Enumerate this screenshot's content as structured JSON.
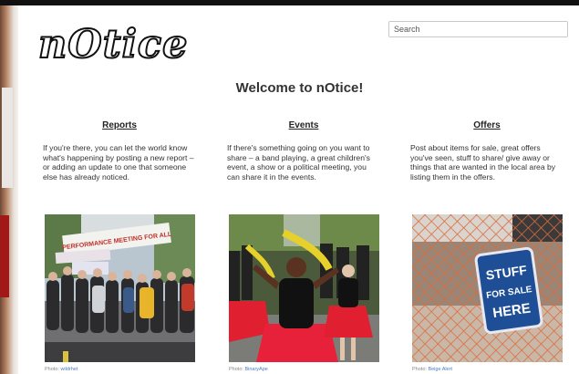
{
  "header": {
    "logo_text": "nOtice",
    "search_placeholder": "Search"
  },
  "main": {
    "welcome": "Welcome to nOtice!",
    "columns": [
      {
        "heading": "Reports",
        "text": "If you're there, you can let the world know what's happening by posting a new report – or adding an update to one that someone else has already noticed.",
        "photo_credit_prefix": "Photo:",
        "photo_credit_name": "wildrhet"
      },
      {
        "heading": "Events",
        "text": "If there's something going on you want to share – a band playing, a great children's event, a show or a political meeting, you can share it in the events.",
        "photo_credit_prefix": "Photo:",
        "photo_credit_name": "BinaryApe"
      },
      {
        "heading": "Offers",
        "text": "Post about items for sale, great offers you've seen, stuff to share/ give away or things that are wanted in the local area by listing them in the offers.",
        "photo_credit_prefix": "Photo:",
        "photo_credit_name": "Beige Alert"
      }
    ],
    "photos": {
      "reports_banner": "PERFORMANCE MEETING FOR ALL",
      "offers_sign": [
        "STUFF",
        "FOR SALE",
        "HERE"
      ]
    }
  }
}
